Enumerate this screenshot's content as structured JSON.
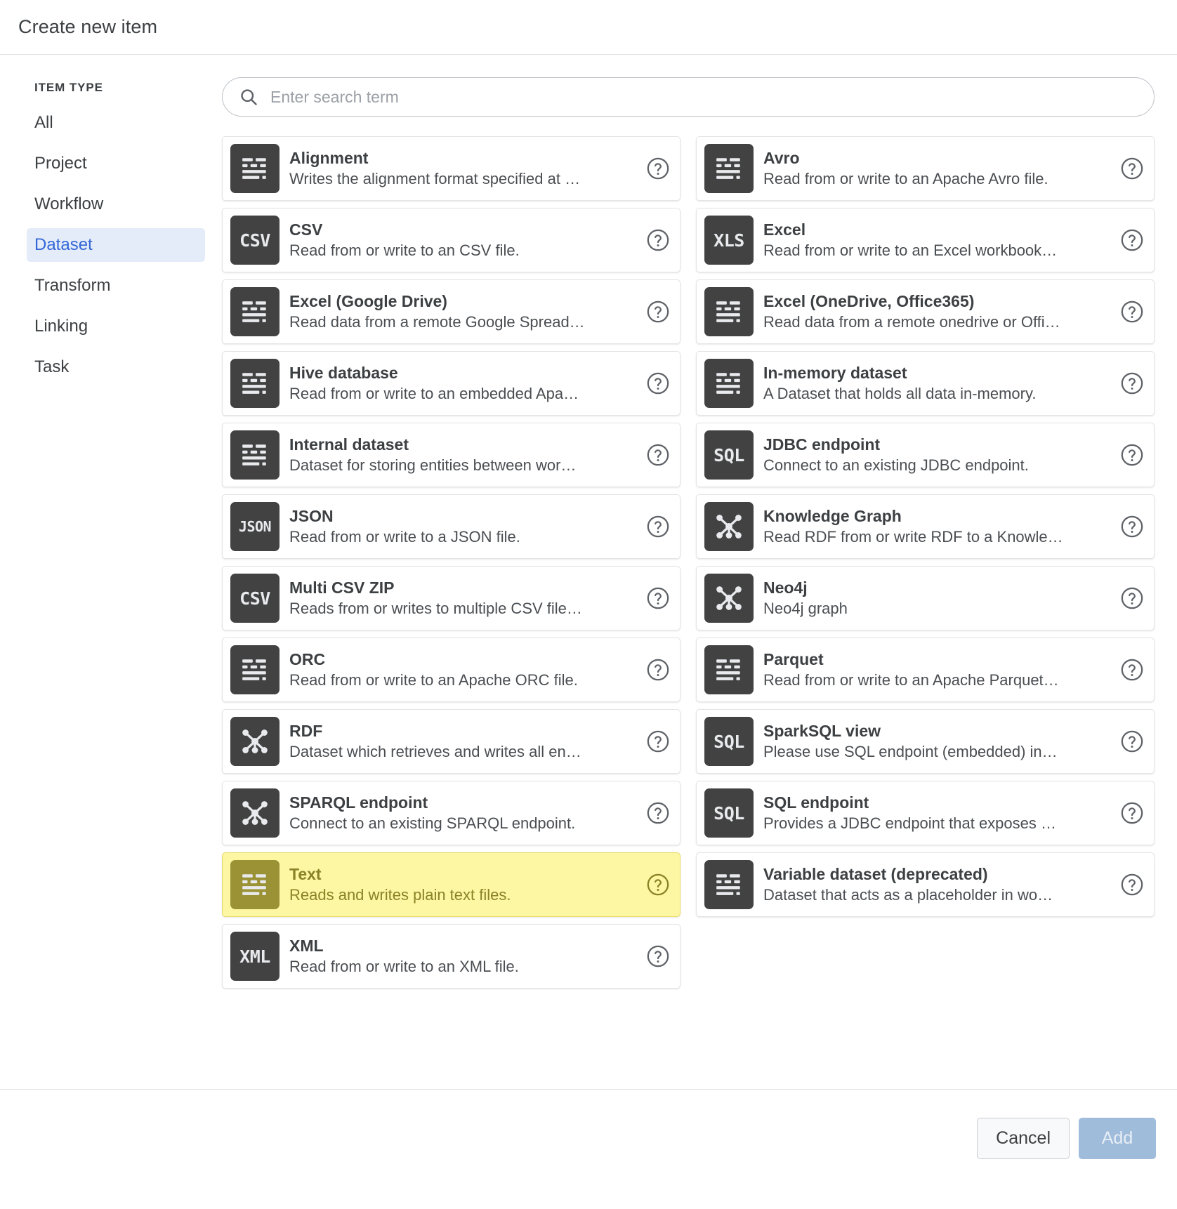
{
  "header": {
    "title": "Create new item"
  },
  "sidebar": {
    "heading": "ITEM TYPE",
    "items": [
      {
        "label": "All",
        "active": false
      },
      {
        "label": "Project",
        "active": false
      },
      {
        "label": "Workflow",
        "active": false
      },
      {
        "label": "Dataset",
        "active": true
      },
      {
        "label": "Transform",
        "active": false
      },
      {
        "label": "Linking",
        "active": false
      },
      {
        "label": "Task",
        "active": false
      }
    ]
  },
  "search": {
    "placeholder": "Enter search term",
    "value": "",
    "icon": "search-icon"
  },
  "colors": {
    "accent": "#3367d6",
    "sidebar_active_bg": "#e4ecf9",
    "icon_bg": "#424242",
    "highlight_bg": "#fdf6a2",
    "highlight_icon_bg": "#9b9236",
    "highlight_text": "#8a8227",
    "add_button_bg": "#9fbcdb"
  },
  "cards": [
    {
      "title": "Alignment",
      "desc": "Writes the alignment format specified at …",
      "icon": "dataset-doc-icon",
      "glyph": "doc",
      "highlight": false,
      "help": "help-icon"
    },
    {
      "title": "Avro",
      "desc": "Read from or write to an Apache Avro file.",
      "icon": "dataset-doc-icon",
      "glyph": "doc",
      "highlight": false,
      "help": "help-icon"
    },
    {
      "title": "CSV",
      "desc": "Read from or write to an CSV file.",
      "icon": "csv-icon",
      "glyph": "text",
      "glyph_text": "CSV",
      "highlight": false,
      "help": "help-icon"
    },
    {
      "title": "Excel",
      "desc": "Read from or write to an Excel workbook…",
      "icon": "xls-icon",
      "glyph": "text",
      "glyph_text": "XLS",
      "highlight": false,
      "help": "help-icon"
    },
    {
      "title": "Excel (Google Drive)",
      "desc": "Read data from a remote Google Spread…",
      "icon": "dataset-doc-icon",
      "glyph": "doc",
      "highlight": false,
      "help": "help-icon"
    },
    {
      "title": "Excel (OneDrive, Office365)",
      "desc": "Read data from a remote onedrive or Offi…",
      "icon": "dataset-doc-icon",
      "glyph": "doc",
      "highlight": false,
      "help": "help-icon"
    },
    {
      "title": "Hive database",
      "desc": "Read from or write to an embedded Apa…",
      "icon": "dataset-doc-icon",
      "glyph": "doc",
      "highlight": false,
      "help": "help-icon"
    },
    {
      "title": "In-memory dataset",
      "desc": "A Dataset that holds all data in-memory.",
      "icon": "dataset-doc-icon",
      "glyph": "doc",
      "highlight": false,
      "help": "help-icon"
    },
    {
      "title": "Internal dataset",
      "desc": "Dataset for storing entities between wor…",
      "icon": "dataset-doc-icon",
      "glyph": "doc",
      "highlight": false,
      "help": "help-icon"
    },
    {
      "title": "JDBC endpoint",
      "desc": "Connect to an existing JDBC endpoint.",
      "icon": "sql-icon",
      "glyph": "text",
      "glyph_text": "SQL",
      "highlight": false,
      "help": "help-icon"
    },
    {
      "title": "JSON",
      "desc": "Read from or write to a JSON file.",
      "icon": "json-icon",
      "glyph": "text",
      "glyph_text": "JSON",
      "highlight": false,
      "help": "help-icon"
    },
    {
      "title": "Knowledge Graph",
      "desc": "Read RDF from or write RDF to a Knowle…",
      "icon": "graph-icon",
      "glyph": "graph",
      "highlight": false,
      "help": "help-icon"
    },
    {
      "title": "Multi CSV ZIP",
      "desc": "Reads from or writes to multiple CSV file…",
      "icon": "csv-icon",
      "glyph": "text",
      "glyph_text": "CSV",
      "highlight": false,
      "help": "help-icon"
    },
    {
      "title": "Neo4j",
      "desc": "Neo4j graph",
      "icon": "graph-icon",
      "glyph": "graph",
      "highlight": false,
      "help": "help-icon"
    },
    {
      "title": "ORC",
      "desc": "Read from or write to an Apache ORC file.",
      "icon": "dataset-doc-icon",
      "glyph": "doc",
      "highlight": false,
      "help": "help-icon"
    },
    {
      "title": "Parquet",
      "desc": "Read from or write to an Apache Parquet…",
      "icon": "dataset-doc-icon",
      "glyph": "doc",
      "highlight": false,
      "help": "help-icon"
    },
    {
      "title": "RDF",
      "desc": "Dataset which retrieves and writes all en…",
      "icon": "graph-icon",
      "glyph": "graph",
      "highlight": false,
      "help": "help-icon"
    },
    {
      "title": "SparkSQL view",
      "desc": "Please use SQL endpoint (embedded) in…",
      "icon": "sql-icon",
      "glyph": "text",
      "glyph_text": "SQL",
      "highlight": false,
      "help": "help-icon"
    },
    {
      "title": "SPARQL endpoint",
      "desc": "Connect to an existing SPARQL endpoint.",
      "icon": "graph-icon",
      "glyph": "graph",
      "highlight": false,
      "help": "help-icon"
    },
    {
      "title": "SQL endpoint",
      "desc": "Provides a JDBC endpoint that exposes …",
      "icon": "sql-icon",
      "glyph": "text",
      "glyph_text": "SQL",
      "highlight": false,
      "help": "help-icon"
    },
    {
      "title": "Text",
      "desc": "Reads and writes plain text files.",
      "icon": "dataset-doc-icon",
      "glyph": "doc",
      "highlight": true,
      "help": "help-icon"
    },
    {
      "title": "Variable dataset (deprecated)",
      "desc": "Dataset that acts as a placeholder in wo…",
      "icon": "dataset-doc-icon",
      "glyph": "doc",
      "highlight": false,
      "help": "help-icon"
    },
    {
      "title": "XML",
      "desc": "Read from or write to an XML file.",
      "icon": "xml-icon",
      "glyph": "text",
      "glyph_text": "XML",
      "highlight": false,
      "help": "help-icon"
    }
  ],
  "footer": {
    "cancel_label": "Cancel",
    "add_label": "Add"
  }
}
